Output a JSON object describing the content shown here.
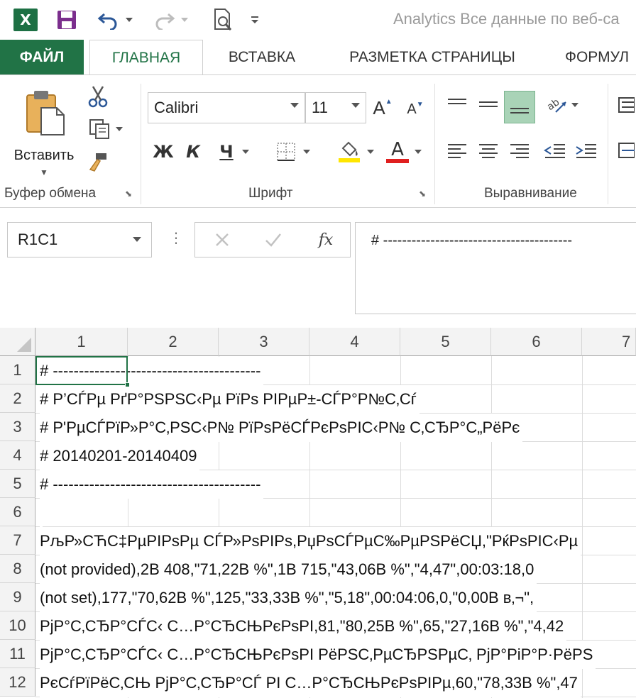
{
  "window": {
    "title": "Analytics Все данные по веб-са"
  },
  "icons": {
    "excel": "excel-logo-icon",
    "save": "save-icon",
    "undo": "undo-icon",
    "redo": "redo-icon",
    "print_preview": "print-preview-icon",
    "customize": "customize-qat-icon"
  },
  "quick_access": {
    "excel_letter": "X"
  },
  "tabs": [
    {
      "label": "ФАЙЛ"
    },
    {
      "label": "ГЛАВНАЯ"
    },
    {
      "label": "ВСТАВКА"
    },
    {
      "label": "РАЗМЕТКА СТРАНИЦЫ"
    },
    {
      "label": "ФОРМУЛ"
    }
  ],
  "ribbon": {
    "clipboard": {
      "paste_label": "Вставить",
      "group_label": "Буфер обмена"
    },
    "font": {
      "font_name": "Calibri",
      "font_size": "11",
      "bold": "Ж",
      "italic": "К",
      "underline": "Ч",
      "grow": "A",
      "shrink": "A",
      "font_color_letter": "A",
      "group_label": "Шрифт"
    },
    "alignment": {
      "group_label": "Выравнивание"
    }
  },
  "colors": {
    "accent": "#217346",
    "highlight_yellow": "#ffe600",
    "font_red": "#e01f1f"
  },
  "formula_bar": {
    "name_box": "R1C1",
    "fx": "fx",
    "content": "# ----------------------------------------"
  },
  "sheet": {
    "columns": [
      "1",
      "2",
      "3",
      "4",
      "5",
      "6",
      "7"
    ],
    "rows": [
      {
        "num": "1",
        "text": "# ----------------------------------------"
      },
      {
        "num": "2",
        "text": "# Р’СЃРµ РґР°РЅРЅС‹Рµ РїРѕ РІРµР±-СЃР°Р№С‚Сѓ"
      },
      {
        "num": "3",
        "text": "# Р'РµСЃРїР»Р°С‚РЅС‹Р№ РїРѕРёСЃРєРѕРІС‹Р№ С‚СЂР°С„РёРє"
      },
      {
        "num": "4",
        "text": "# 20140201-20140409"
      },
      {
        "num": "5",
        "text": "# ----------------------------------------"
      },
      {
        "num": "6",
        "text": ""
      },
      {
        "num": "7",
        "text": "РљР»СЋС‡РµРІРѕРµ СЃР»РѕРІРѕ,РџРѕСЃРµС‰РµРЅРёСЏ,\"РќРѕРІС‹Рµ"
      },
      {
        "num": "8",
        "text": "(not provided),2В 408,\"71,22В %\",1В 715,\"43,06В %\",\"4,47\",00:03:18,0"
      },
      {
        "num": "9",
        "text": "(not set),177,\"70,62В %\",125,\"33,33В %\",\"5,18\",00:04:06,0,\"0,00В в‚¬\","
      },
      {
        "num": "10",
        "text": "РјР°С‚СЂР°СЃС‹ С…Р°СЂСЊРєРѕРІ,81,\"80,25В %\",65,\"27,16В %\",\"4,42"
      },
      {
        "num": "11",
        "text": "РјР°С‚СЂР°СЃС‹ С…Р°СЂСЊРєРѕРІ РёРЅС‚РµСЂРЅРµС‚ РјР°РіР°Р·РёРЅ"
      },
      {
        "num": "12",
        "text": "РєСѓРїРёС‚СЊ РјР°С‚СЂР°СЃ РІ С…Р°СЂСЊРєРѕРІРµ,60,\"78,33В %\",47"
      }
    ]
  }
}
